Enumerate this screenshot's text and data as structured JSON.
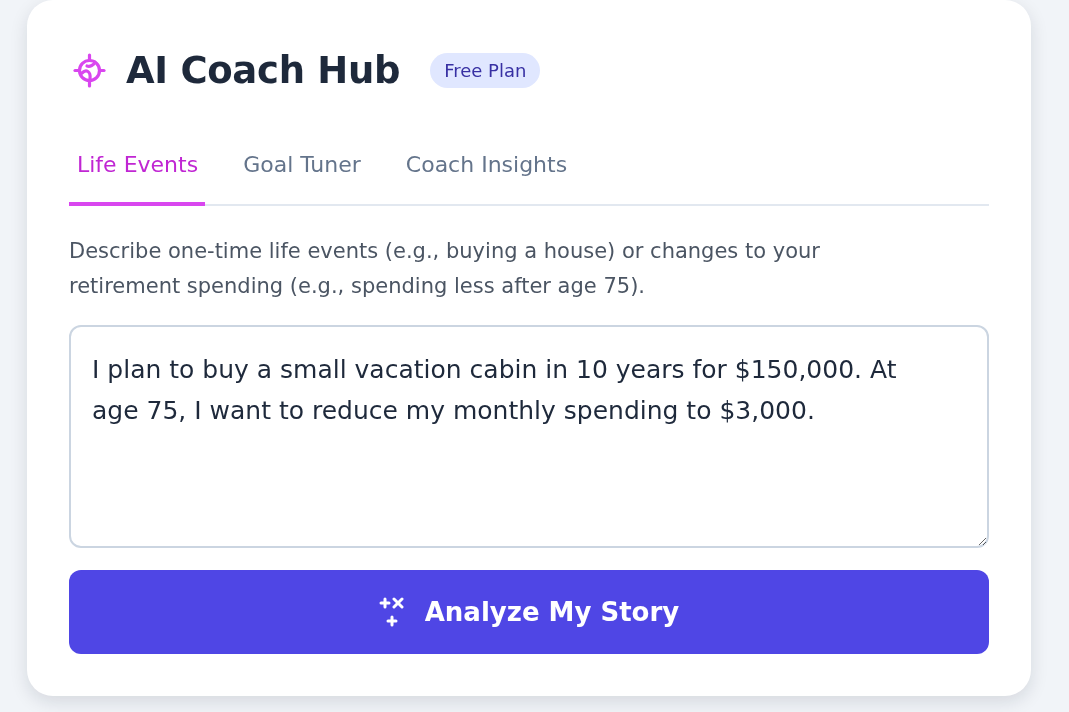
{
  "header": {
    "title": "AI Coach Hub",
    "badge": "Free Plan"
  },
  "tabs": [
    {
      "label": "Life Events",
      "selected": true
    },
    {
      "label": "Goal Tuner",
      "selected": false
    },
    {
      "label": "Coach Insights",
      "selected": false
    }
  ],
  "description": "Describe one-time life events (e.g., buying a house) or changes to your retirement spending (e.g., spending less after age 75).",
  "story_input": {
    "value": "I plan to buy a small vacation cabin in 10 years for $150,000. At age 75, I want to reduce my monthly spending to $3,000."
  },
  "analyze_button": {
    "label": "Analyze My Story"
  }
}
